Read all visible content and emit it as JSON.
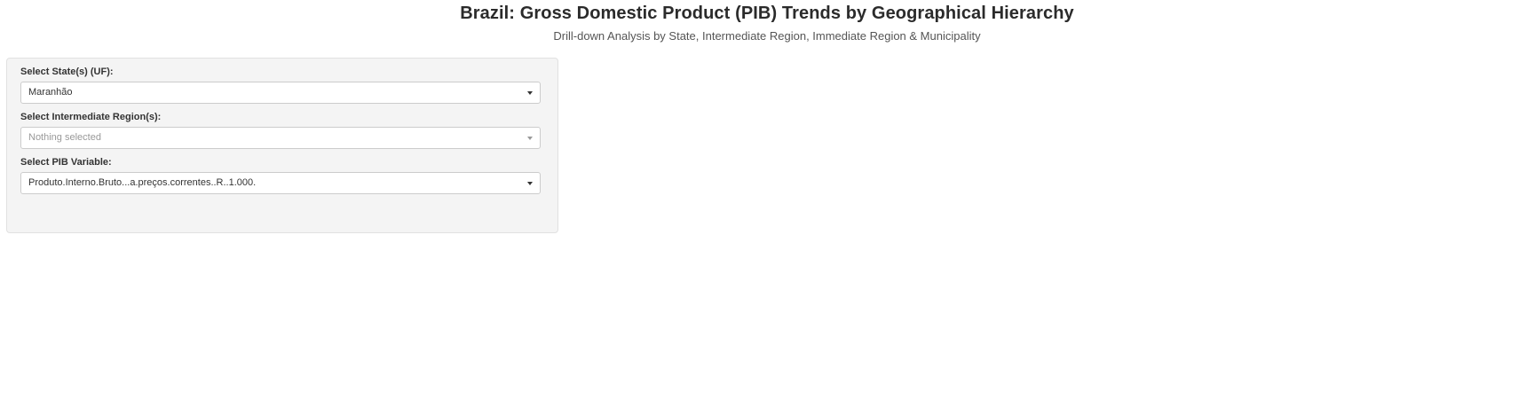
{
  "header": {
    "title": "Brazil: Gross Domestic Product (PIB) Trends by Geographical Hierarchy",
    "subtitle": "Drill-down Analysis by State, Intermediate Region, Immediate Region & Municipality"
  },
  "filters": {
    "state": {
      "label": "Select State(s) (UF):",
      "value": "Maranhão"
    },
    "intermediate_region": {
      "label": "Select Intermediate Region(s):",
      "value": "Nothing selected"
    },
    "pib_variable": {
      "label": "Select PIB Variable:",
      "value": "Produto.Interno.Bruto...a.preços.correntes..R..1.000."
    }
  },
  "colors": {
    "panel_background": "#f4f4f4",
    "panel_border": "#e1e1e1",
    "placeholder_text": "#999999"
  },
  "icons": {
    "dropdown": "chevron-down-icon"
  }
}
